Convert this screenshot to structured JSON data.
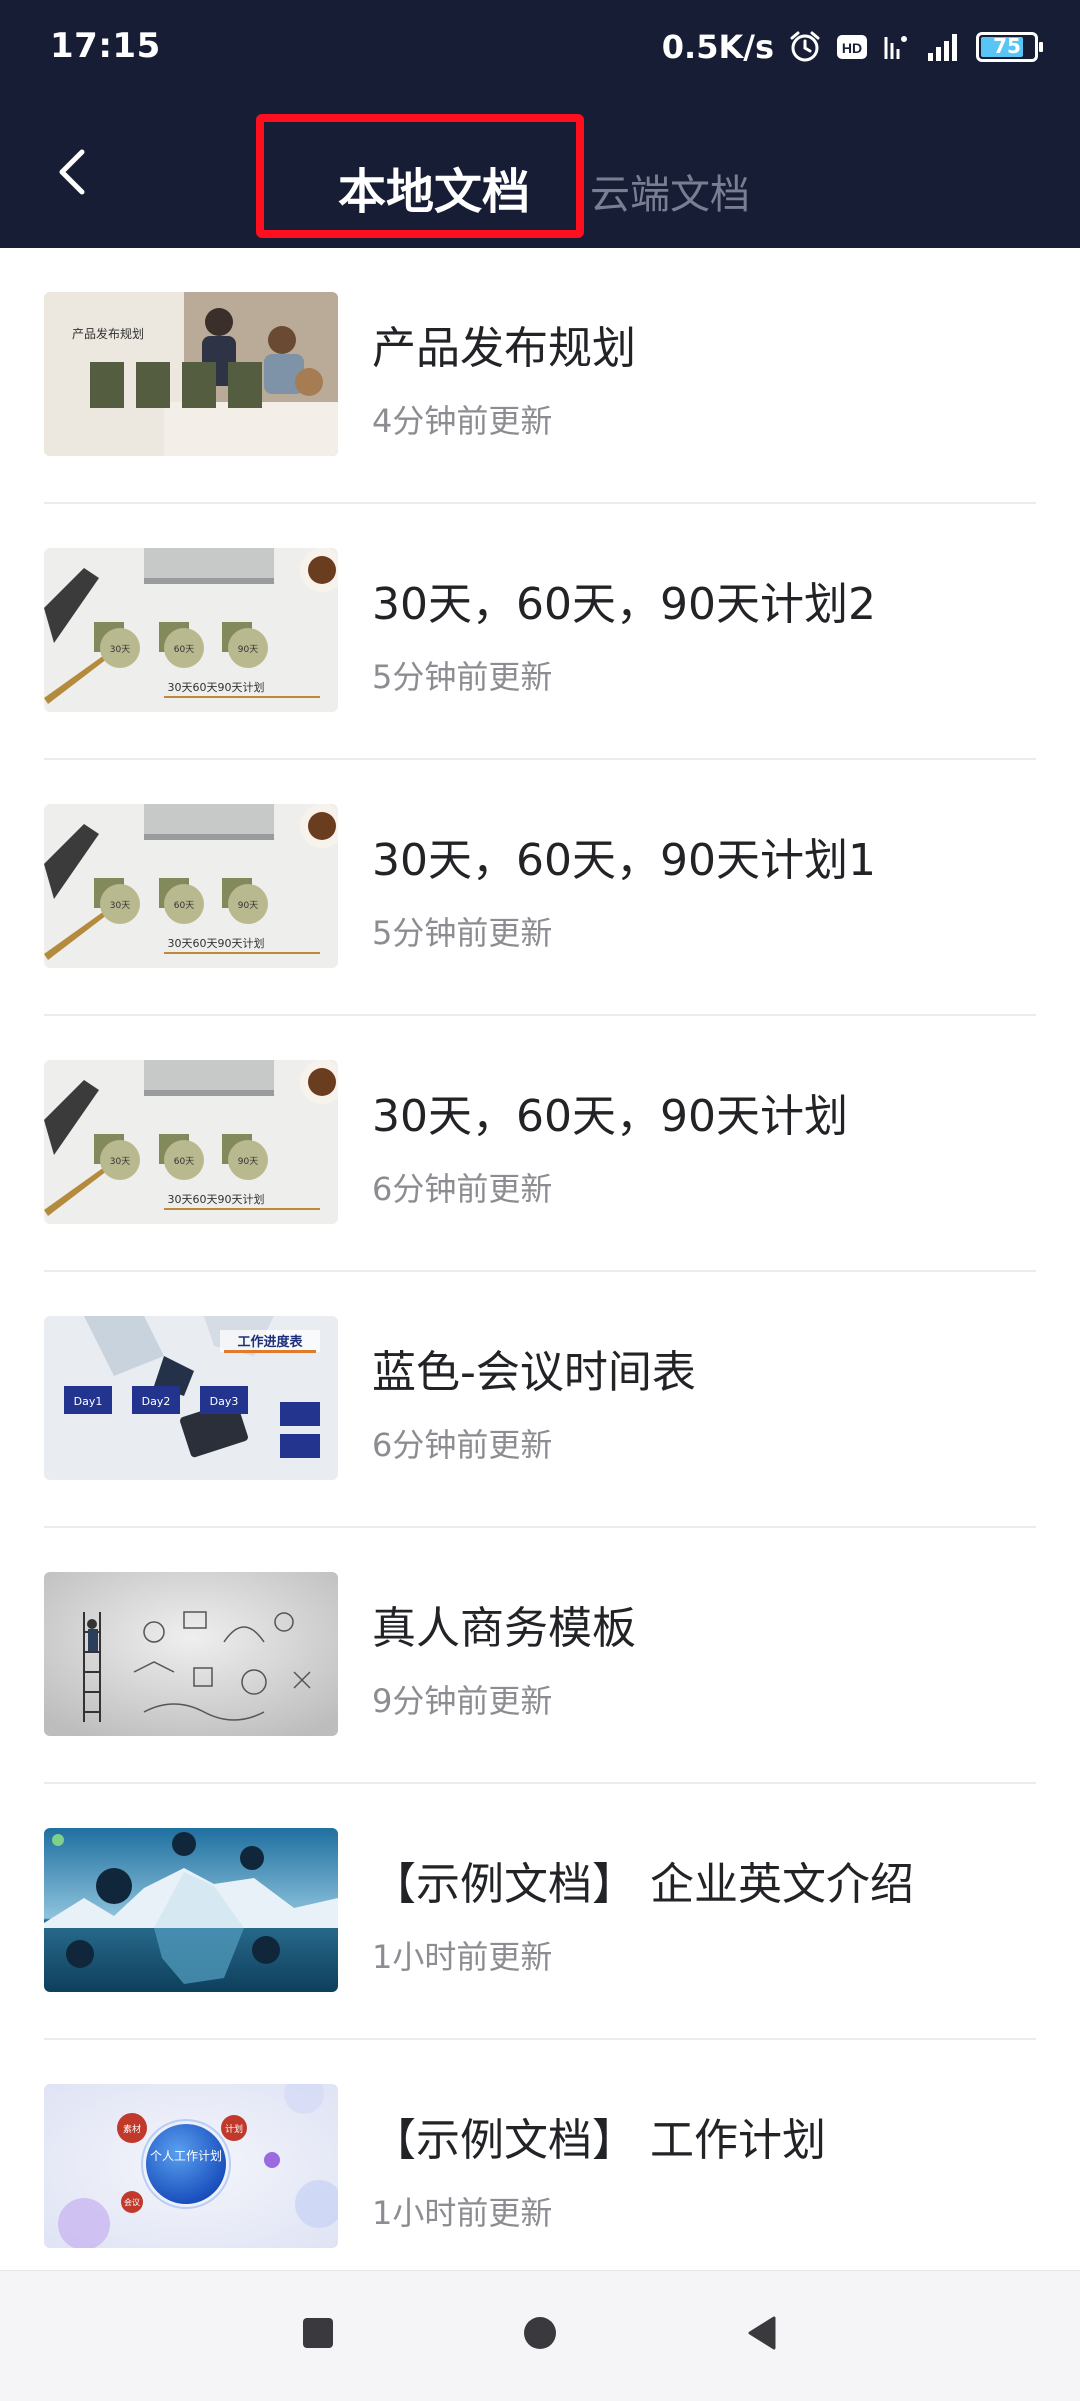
{
  "status_bar": {
    "time": "17:15",
    "network_speed": "0.5K/s",
    "hd_badge": "HD",
    "battery_level": "75",
    "icons": [
      "alarm-icon",
      "hd-icon",
      "wifi-icon",
      "signal-icon",
      "battery-icon"
    ]
  },
  "nav": {
    "back_icon": "chevron-left-icon",
    "tabs": [
      {
        "label": "本地文档",
        "selected": true
      },
      {
        "label": "云端文档",
        "selected": false
      }
    ]
  },
  "documents": [
    {
      "title": "产品发布规划",
      "updated": "4分钟前更新",
      "thumb": {
        "style": "office-meeting",
        "heading": "产品发布规划"
      }
    },
    {
      "title": "30天，60天，90天计划2",
      "updated": "5分钟前更新",
      "thumb": {
        "style": "desk-plan",
        "labels": [
          "30天",
          "60天",
          "90天"
        ],
        "caption": "30天60天90天计划"
      }
    },
    {
      "title": "30天，60天，90天计划1",
      "updated": "5分钟前更新",
      "thumb": {
        "style": "desk-plan",
        "labels": [
          "30天",
          "60天",
          "90天"
        ],
        "caption": "30天60天90天计划"
      }
    },
    {
      "title": "30天，60天，90天计划",
      "updated": "6分钟前更新",
      "thumb": {
        "style": "desk-plan",
        "labels": [
          "30天",
          "60天",
          "90天"
        ],
        "caption": "30天60天90天计划"
      }
    },
    {
      "title": "蓝色-会议时间表",
      "updated": "6分钟前更新",
      "thumb": {
        "style": "blue-schedule",
        "labels": [
          "Day1",
          "Day2",
          "Day3"
        ],
        "caption": "工作进度表"
      }
    },
    {
      "title": "真人商务模板",
      "updated": "9分钟前更新",
      "thumb": {
        "style": "doodle-sketch"
      }
    },
    {
      "title": "【示例文档】 企业英文介绍",
      "updated": "1小时前更新",
      "thumb": {
        "style": "iceberg"
      }
    },
    {
      "title": "【示例文档】 工作计划",
      "updated": "1小时前更新",
      "thumb": {
        "style": "bubble-plan",
        "center": "个人工作计划",
        "labels": [
          "素材",
          "计划",
          "会议"
        ]
      }
    }
  ],
  "system_nav": [
    "recent-apps-button",
    "home-button",
    "back-button"
  ],
  "colors": {
    "header_bg": "#181d36",
    "highlight_box": "#ff0f1e",
    "title_text": "#222326",
    "meta_text": "#8c8c92"
  }
}
